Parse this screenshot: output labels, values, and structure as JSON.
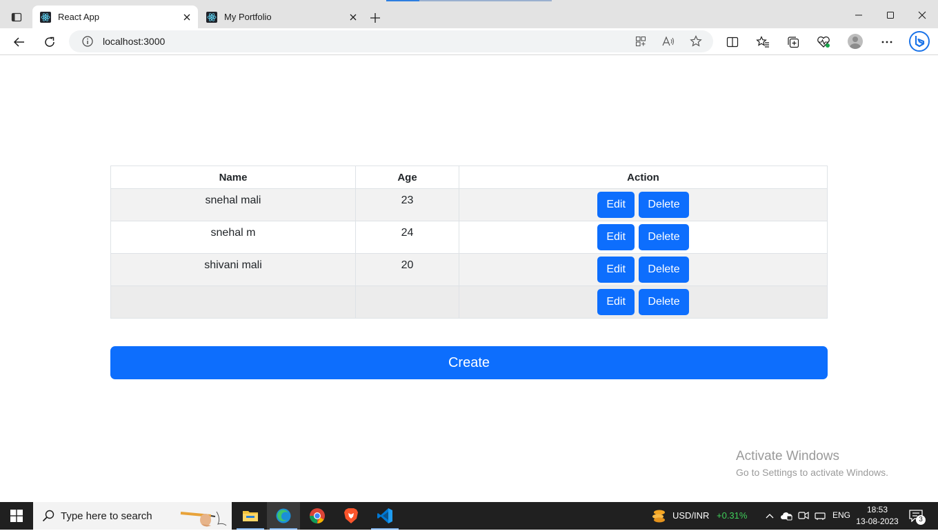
{
  "browser": {
    "tabs": [
      {
        "title": "React App",
        "active": true
      },
      {
        "title": "My Portfolio",
        "active": false
      }
    ],
    "url": "localhost:3000"
  },
  "table": {
    "headers": [
      "Name",
      "Age",
      "Action"
    ],
    "rows": [
      {
        "name": "snehal mali",
        "age": "23"
      },
      {
        "name": "snehal m",
        "age": "24"
      },
      {
        "name": "shivani mali",
        "age": "20"
      },
      {
        "name": "",
        "age": ""
      }
    ],
    "edit_label": "Edit",
    "delete_label": "Delete"
  },
  "create_label": "Create",
  "watermark": {
    "title": "Activate Windows",
    "subtitle": "Go to Settings to activate Windows."
  },
  "taskbar": {
    "search_placeholder": "Type here to search",
    "ticker_label": "USD/INR",
    "ticker_change": "+0.31%",
    "language": "ENG",
    "time": "18:53",
    "date": "13-08-2023",
    "notification_count": "3"
  },
  "colors": {
    "primary": "#0d6efd",
    "ticker_positive": "#3fcf5a"
  }
}
